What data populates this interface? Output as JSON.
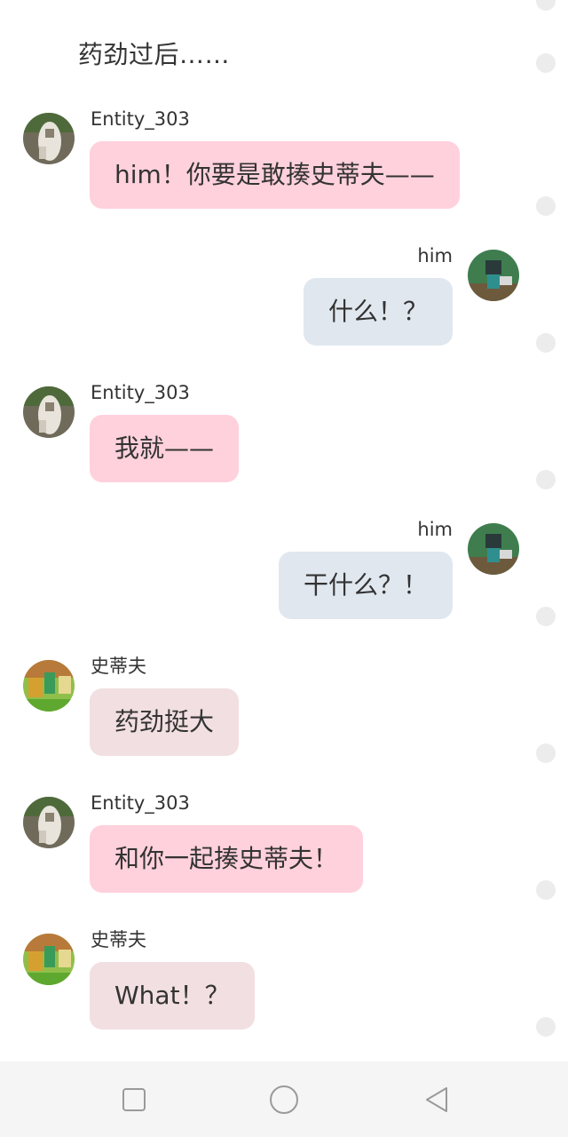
{
  "narration": "药劲过后……",
  "messages": [
    {
      "sender": "Entity_303",
      "text": "him！你要是敢揍史蒂夫——",
      "side": "left",
      "bubble_color": "#ffd1dc"
    },
    {
      "sender": "him",
      "text": "什么！？",
      "side": "right",
      "bubble_color": "#e0e7ef"
    },
    {
      "sender": "Entity_303",
      "text": "我就——",
      "side": "left",
      "bubble_color": "#ffd1dc"
    },
    {
      "sender": "him",
      "text": "干什么？！",
      "side": "right",
      "bubble_color": "#e0e7ef"
    },
    {
      "sender": "史蒂夫",
      "text": "药劲挺大",
      "side": "left",
      "bubble_color": "#f2dfe1"
    },
    {
      "sender": "Entity_303",
      "text": "和你一起揍史蒂夫！",
      "side": "left",
      "bubble_color": "#ffd1dc"
    },
    {
      "sender": "史蒂夫",
      "text": "What！？",
      "side": "left",
      "bubble_color": "#f2dfe1"
    }
  ],
  "navbar": {
    "icons": [
      "recent-apps-icon",
      "home-icon",
      "back-icon"
    ]
  }
}
